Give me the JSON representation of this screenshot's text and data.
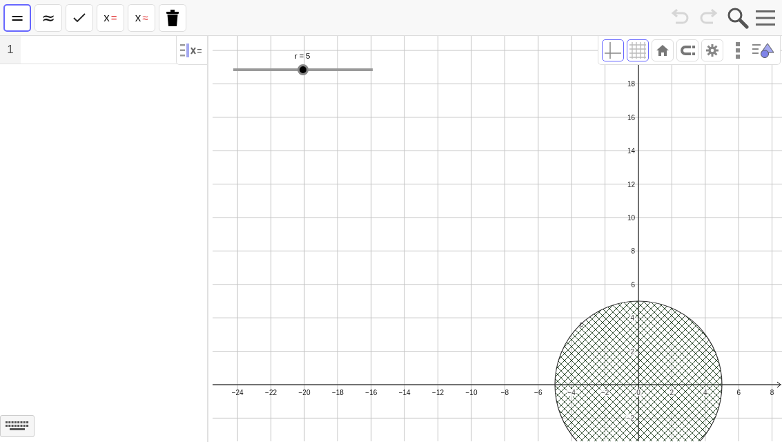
{
  "toolbar": {
    "buttons": [
      {
        "kind": "text",
        "label": "=",
        "selected": true
      },
      {
        "kind": "text",
        "label": "≈",
        "selected": false
      },
      {
        "kind": "check",
        "selected": false
      },
      {
        "kind": "solve",
        "label": "x",
        "mark": "=",
        "selected": false
      },
      {
        "kind": "solve",
        "label": "x",
        "mark": "≈",
        "selected": false
      },
      {
        "kind": "delete",
        "selected": false
      }
    ],
    "undo": {
      "disabled": true
    },
    "redo": {
      "disabled": true
    }
  },
  "cas": {
    "rows": [
      {
        "number": "1"
      }
    ]
  },
  "style_bar": {
    "buttons": [
      {
        "kind": "axes",
        "selected": true
      },
      {
        "kind": "grid",
        "selected": true
      },
      {
        "kind": "home",
        "selected": false
      },
      {
        "kind": "magnet",
        "selected": false
      },
      {
        "kind": "gear",
        "selected": false
      }
    ]
  },
  "graphics": {
    "slider": {
      "label": "r = 5",
      "level": 0.5
    },
    "circle_label": "c",
    "x_ticks": [
      "−24",
      "−22",
      "−20",
      "−18",
      "−16",
      "−14",
      "−12",
      "−10",
      "−8",
      "−6",
      "−4",
      "−2",
      "0",
      "2",
      "4",
      "6",
      "8"
    ],
    "y_ticks": [
      "18",
      "16",
      "14",
      "12",
      "10",
      "8",
      "6",
      "4",
      "2",
      "−2"
    ]
  }
}
